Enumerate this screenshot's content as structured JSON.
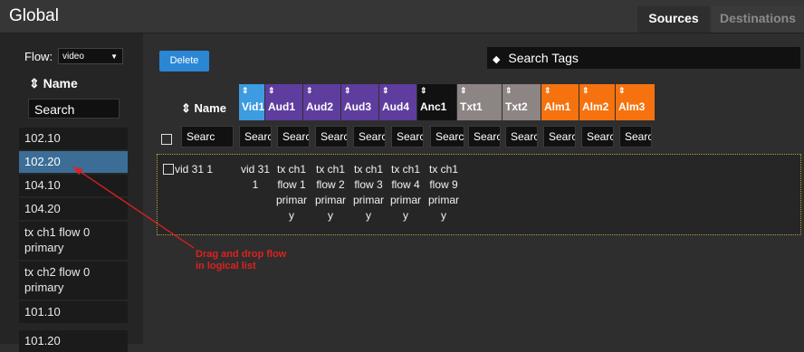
{
  "header": {
    "title": "Global",
    "tabs": [
      {
        "label": "Sources"
      },
      {
        "label": "Destinations"
      }
    ]
  },
  "left_panel": {
    "flow_label": "Flow:",
    "flow_value": "video",
    "name_header": "Name",
    "search_value": "Search",
    "items": [
      "102.10",
      "102.20",
      "104.10",
      "104.20",
      "tx ch1 flow 0 primary",
      "tx ch2 flow 0 primary",
      "101.10",
      "101.20"
    ],
    "selected_index": 1
  },
  "toolbar": {
    "delete_label": "Delete",
    "search_tags_label": "Search Tags"
  },
  "table": {
    "name_header": "Name",
    "columns": [
      {
        "label": "Vid1",
        "color": "#3d9be0"
      },
      {
        "label": "Aud1",
        "color": "#5e3d9e"
      },
      {
        "label": "Aud2",
        "color": "#5e3d9e"
      },
      {
        "label": "Aud3",
        "color": "#5e3d9e"
      },
      {
        "label": "Aud4",
        "color": "#5e3d9e"
      },
      {
        "label": "Anc1",
        "color": "#111111"
      },
      {
        "label": "Txt1",
        "color": "#8d8484"
      },
      {
        "label": "Txt2",
        "color": "#8d8484"
      },
      {
        "label": "Alm1",
        "color": "#f5720f"
      },
      {
        "label": "Alm2",
        "color": "#f5720f"
      },
      {
        "label": "Alm3",
        "color": "#f5720f"
      }
    ],
    "filter_values": [
      "Searc",
      "Searc",
      "Searc",
      "Searc",
      "Searc",
      "Searc",
      "Searcl",
      "Searc",
      "Searc",
      "Searc",
      "Searc",
      "Searc"
    ],
    "row": {
      "name": "vid 31 1",
      "cells": [
        "vid 31 1",
        "tx ch1 flow 1 primary",
        "tx ch1 flow 2 primary",
        "tx ch1 flow 3 primary",
        "tx ch1 flow 4 primary",
        "tx ch1 flow 9 primary"
      ]
    }
  },
  "annotation": {
    "text": "Drag and drop flow in logical list",
    "color": "#e02020"
  }
}
